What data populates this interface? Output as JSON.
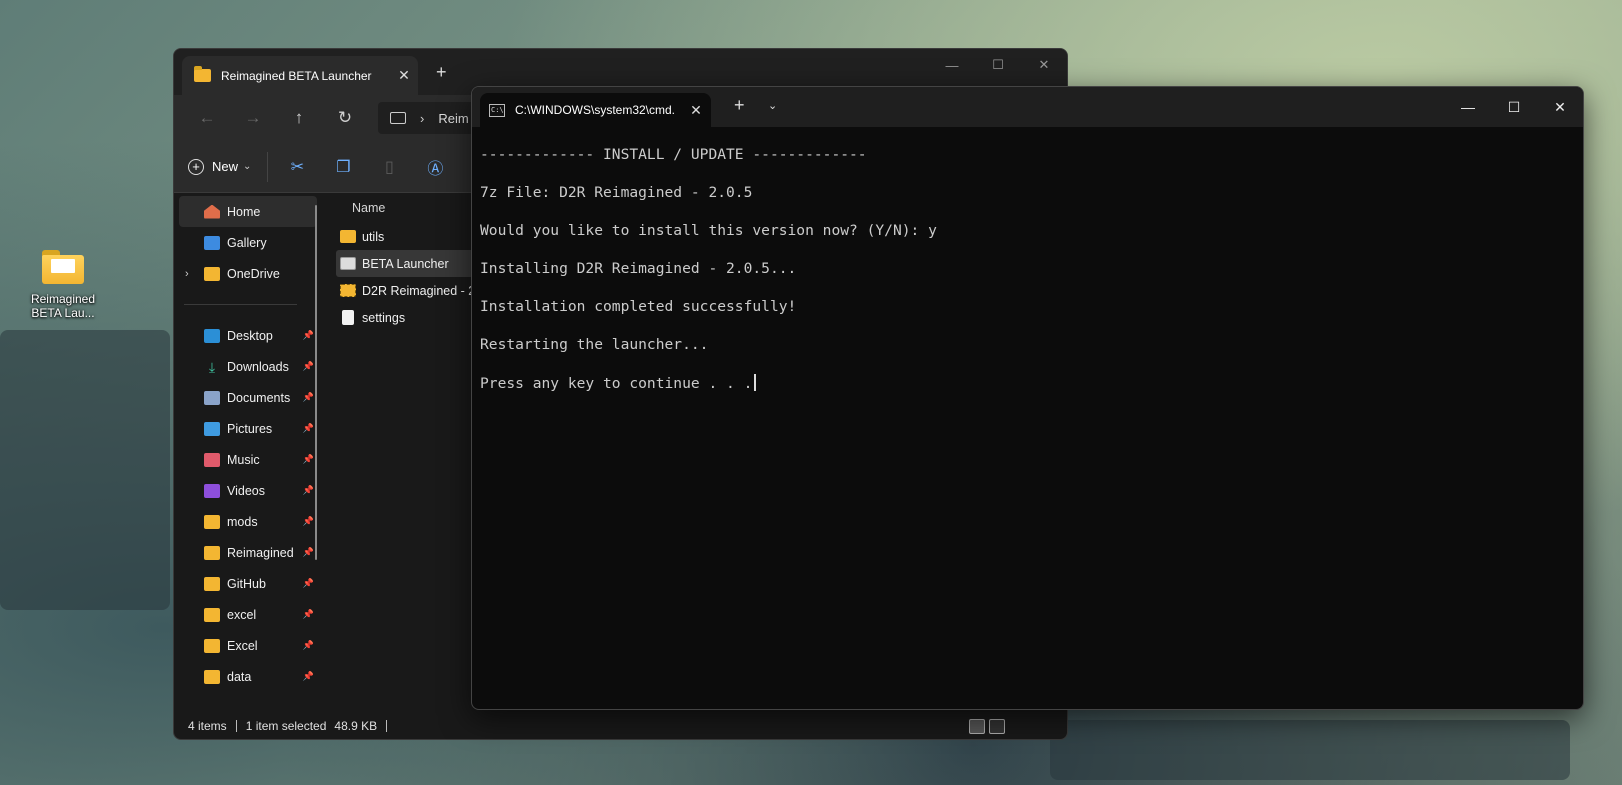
{
  "desktop": {
    "icon_label_line1": "Reimagined",
    "icon_label_line2": "BETA Lau..."
  },
  "explorer": {
    "tab_title": "Reimagined BETA Launcher",
    "address_crumb": "Reim",
    "toolbar": {
      "new_label": "New"
    },
    "nav": {
      "home": "Home",
      "gallery": "Gallery",
      "onedrive": "OneDrive",
      "pinned": [
        "Desktop",
        "Downloads",
        "Documents",
        "Pictures",
        "Music",
        "Videos",
        "mods",
        "Reimagined",
        "GitHub",
        "excel",
        "Excel",
        "data"
      ]
    },
    "column_header": "Name",
    "files": [
      {
        "name": "utils",
        "type": "folder"
      },
      {
        "name": "BETA Launcher",
        "type": "app",
        "selected": true
      },
      {
        "name": "D2R Reimagined - 2",
        "type": "zip"
      },
      {
        "name": "settings",
        "type": "doc"
      }
    ],
    "status": {
      "items": "4 items",
      "selected": "1 item selected",
      "size": "48.9 KB"
    }
  },
  "terminal": {
    "tab_title": "C:\\WINDOWS\\system32\\cmd.",
    "lines": [
      "------------- INSTALL / UPDATE -------------",
      "7z File: D2R Reimagined - 2.0.5",
      "Would you like to install this version now? (Y/N): y",
      "Installing D2R Reimagined - 2.0.5...",
      "Installation completed successfully!",
      "Restarting the launcher...",
      "Press any key to continue . . ."
    ]
  },
  "colors": {
    "folder": "#f3b632",
    "terminal_bg": "#0c0c0c",
    "explorer_bg": "#191919",
    "accent": "#6fb1ff"
  }
}
